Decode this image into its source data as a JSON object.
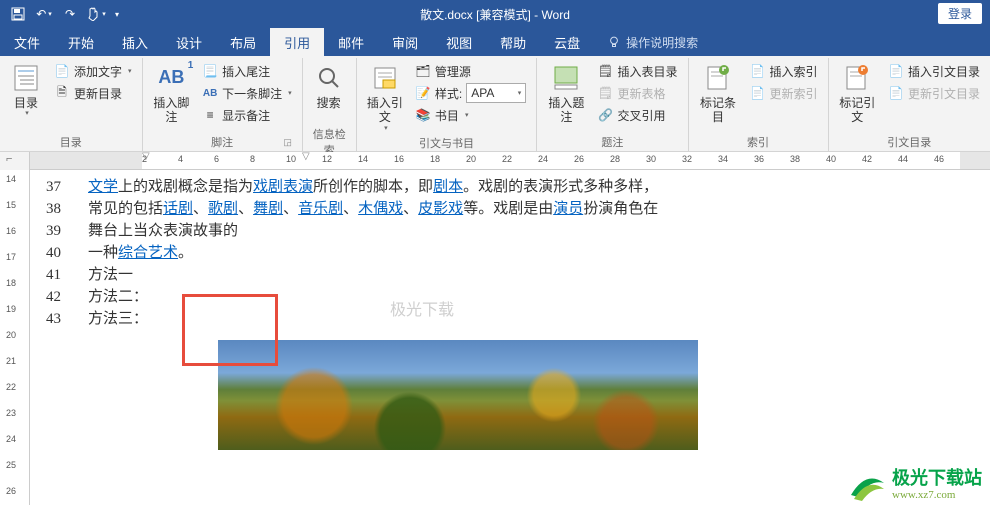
{
  "title": "散文.docx [兼容模式] - Word",
  "login": "登录",
  "qat": {
    "save": "保存",
    "undo": "撤消",
    "redo": "恢复",
    "touch": "触摸/鼠标模式",
    "customize": "自定义"
  },
  "menu": {
    "items": [
      {
        "label": "文件"
      },
      {
        "label": "开始"
      },
      {
        "label": "插入"
      },
      {
        "label": "设计"
      },
      {
        "label": "布局"
      },
      {
        "label": "引用",
        "active": true
      },
      {
        "label": "邮件"
      },
      {
        "label": "审阅"
      },
      {
        "label": "视图"
      },
      {
        "label": "帮助"
      },
      {
        "label": "云盘"
      }
    ],
    "tell_me": "操作说明搜索"
  },
  "ribbon": {
    "toc": {
      "big": "目录",
      "add_text": "添加文字",
      "update": "更新目录",
      "group": "目录"
    },
    "footnote": {
      "big": "插入脚注",
      "big2": "插入脚注",
      "endnote": "插入尾注",
      "next_fn": "下一条脚注",
      "show": "显示备注",
      "group": "脚注",
      "ab": "AB",
      "ab2": "AB"
    },
    "search": {
      "big": "搜索",
      "big2": "搜索",
      "group": "信息检索"
    },
    "citation": {
      "big": "插入引文",
      "big2": "插入引文",
      "manage": "管理源",
      "style_label": "样式:",
      "style_value": "APA",
      "biblio": "书目",
      "group": "引文与书目"
    },
    "caption": {
      "big": "插入题注",
      "big2": "插入题注",
      "insert_tof": "插入表目录",
      "update_tof": "更新表格",
      "cross": "交叉引用",
      "group": "题注"
    },
    "mark": {
      "big": "标记条目",
      "big2": "标记条目",
      "insert_idx": "插入索引",
      "update_idx": "更新索引",
      "group": "索引"
    },
    "cite": {
      "big": "标记引文",
      "big2": "标记引文",
      "insert_toa": "插入引文目录",
      "update_toa": "更新引文目录",
      "group": "引文目录"
    }
  },
  "ruler_h": [
    "2",
    "4",
    "6",
    "8",
    "10",
    "12",
    "14",
    "16",
    "18",
    "20",
    "22",
    "24",
    "26",
    "28",
    "30",
    "32",
    "34",
    "36",
    "38",
    "40",
    "42",
    "44",
    "46"
  ],
  "ruler_v": [
    "14",
    "15",
    "16",
    "17",
    "18",
    "19",
    "20",
    "21",
    "22",
    "23",
    "24",
    "25",
    "26"
  ],
  "doc": {
    "lines_pre": [
      {
        "n": "37",
        "parts": [
          {
            "t": "文学",
            "link": true
          },
          {
            "t": "上的戏剧概念是指为"
          },
          {
            "t": "戏剧表演",
            "link": true
          },
          {
            "t": "所创作的脚本，即"
          },
          {
            "t": "剧本",
            "link": true
          },
          {
            "t": "。戏剧的表演形式多种多样，"
          }
        ]
      },
      {
        "n": "38",
        "parts": [
          {
            "t": "常见的包括"
          },
          {
            "t": "话剧",
            "link": true
          },
          {
            "t": "、"
          },
          {
            "t": "歌剧",
            "link": true
          },
          {
            "t": "、"
          },
          {
            "t": "舞剧",
            "link": true
          },
          {
            "t": "、"
          },
          {
            "t": "音乐剧",
            "link": true
          },
          {
            "t": "、"
          },
          {
            "t": "木偶戏",
            "link": true
          },
          {
            "t": "、"
          },
          {
            "t": "皮影戏",
            "link": true
          },
          {
            "t": "等。戏剧是由"
          },
          {
            "t": "演员",
            "link": true
          },
          {
            "t": "扮演角色在"
          }
        ]
      },
      {
        "n": "39",
        "parts": [
          {
            "t": "舞台上当众表演故事的"
          }
        ]
      },
      {
        "n": "40",
        "parts": [
          {
            "t": "一种"
          },
          {
            "t": "综合艺术",
            "link": true
          },
          {
            "t": "。"
          }
        ]
      }
    ],
    "boxed": [
      {
        "n": "41",
        "text": "方法一"
      },
      {
        "n": "42",
        "text": "方法二："
      },
      {
        "n": "43",
        "text": "方法三："
      }
    ],
    "watermark": "极光下载"
  },
  "logo": {
    "name": "极光下载站",
    "url": "www.xz7.com"
  }
}
